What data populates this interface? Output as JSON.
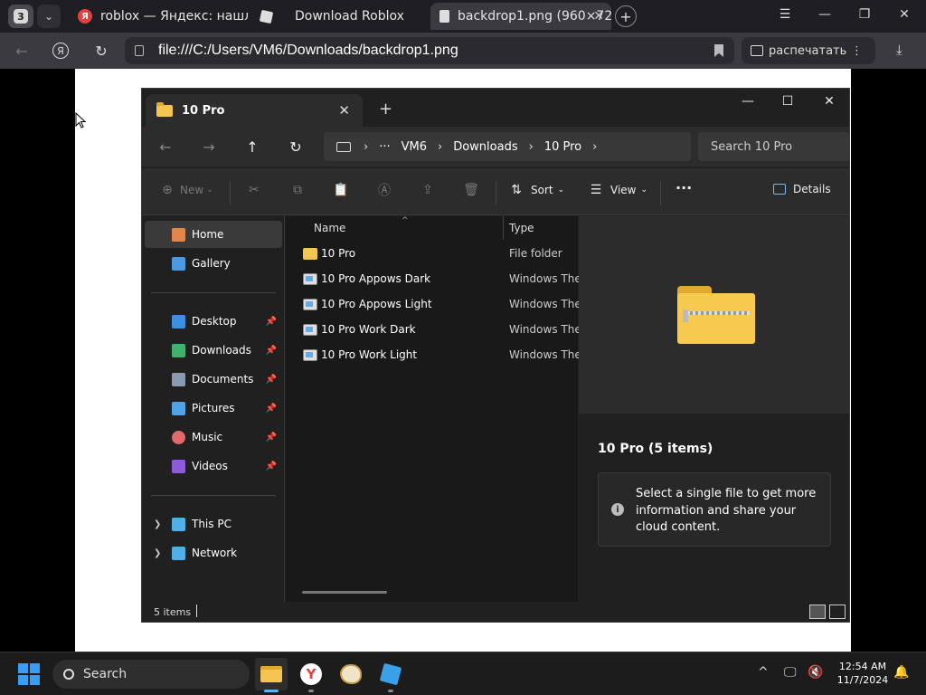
{
  "browser": {
    "tab_count": "3",
    "tabs": [
      {
        "title": "roblox — Яндекс: нашлось",
        "favicon": "yandex-icon"
      },
      {
        "title": "Download Roblox",
        "favicon": "roblox-icon"
      },
      {
        "title": "backdrop1.png (960×72",
        "favicon": "file-icon"
      }
    ],
    "url": "file:///C:/Users/VM6/Downloads/backdrop1.png",
    "print_label": "распечатать"
  },
  "explorer": {
    "tab_title": "10 Pro",
    "breadcrumb": [
      "VM6",
      "Downloads",
      "10 Pro"
    ],
    "search_placeholder": "Search 10 Pro",
    "commands": {
      "new": "New",
      "sort": "Sort",
      "view": "View",
      "details": "Details"
    },
    "sidebar": {
      "top": [
        {
          "label": "Home",
          "icon": "home-icon",
          "color": "#e3864a"
        },
        {
          "label": "Gallery",
          "icon": "gallery-icon",
          "color": "#4a9be3"
        }
      ],
      "pinned": [
        {
          "label": "Desktop",
          "icon": "desktop-icon",
          "color": "#3d8fe0"
        },
        {
          "label": "Downloads",
          "icon": "downloads-icon",
          "color": "#3fb36d"
        },
        {
          "label": "Documents",
          "icon": "documents-icon",
          "color": "#8a9bb0"
        },
        {
          "label": "Pictures",
          "icon": "pictures-icon",
          "color": "#4fa3e6"
        },
        {
          "label": "Music",
          "icon": "music-icon",
          "color": "#e06a6a"
        },
        {
          "label": "Videos",
          "icon": "videos-icon",
          "color": "#8e5ad8"
        }
      ],
      "bottom": [
        {
          "label": "This PC",
          "icon": "this-pc-icon",
          "color": "#4fb0e8"
        },
        {
          "label": "Network",
          "icon": "network-icon",
          "color": "#4fb0e8"
        }
      ]
    },
    "columns": {
      "name": "Name",
      "type": "Type"
    },
    "files": [
      {
        "name": "10 Pro",
        "type": "File folder",
        "icon": "folder-icon"
      },
      {
        "name": "10 Pro Appows Dark",
        "type": "Windows Ther",
        "icon": "theme-icon"
      },
      {
        "name": "10 Pro Appows Light",
        "type": "Windows Ther",
        "icon": "theme-icon"
      },
      {
        "name": "10 Pro Work Dark",
        "type": "Windows Ther",
        "icon": "theme-icon"
      },
      {
        "name": "10 Pro Work Light",
        "type": "Windows Ther",
        "icon": "theme-icon"
      }
    ],
    "details_pane": {
      "title": "10 Pro (5 items)",
      "info": "Select a single file to get more information and share your cloud content."
    },
    "status": {
      "count": "5 items"
    }
  },
  "taskbar": {
    "search": "Search",
    "time": "12:54 AM",
    "date": "11/7/2024"
  }
}
